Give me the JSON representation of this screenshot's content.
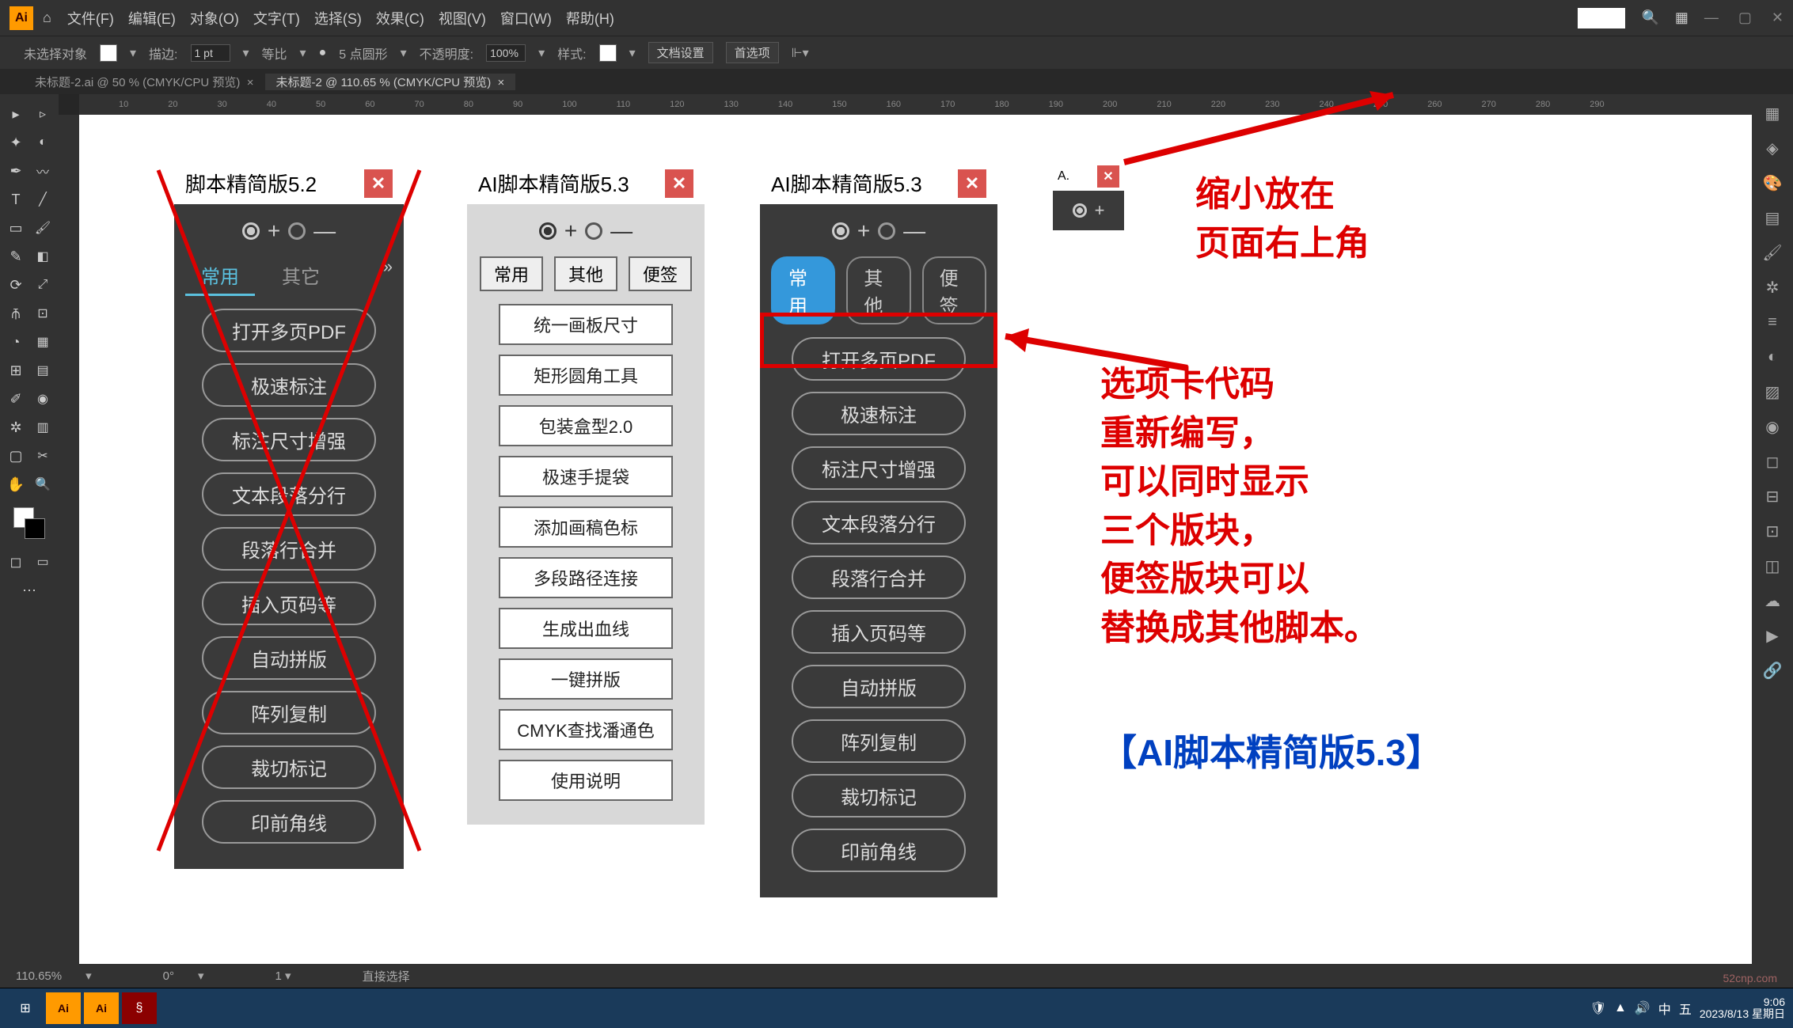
{
  "menubar": {
    "items": [
      "文件(F)",
      "编辑(E)",
      "对象(O)",
      "文字(T)",
      "选择(S)",
      "效果(C)",
      "视图(V)",
      "窗口(W)",
      "帮助(H)"
    ]
  },
  "optbar": {
    "no_sel": "未选择对象",
    "stroke_lbl": "描边:",
    "stroke_val": "1 pt",
    "uniform": "等比",
    "pt5": "5 点圆形",
    "opacity_lbl": "不透明度:",
    "opacity_val": "100%",
    "style_lbl": "样式:",
    "doc_setup": "文档设置",
    "prefs": "首选项"
  },
  "tabs": {
    "t1": "未标题-2.ai @ 50 % (CMYK/CPU 预览)",
    "t2": "未标题-2 @ 110.65 % (CMYK/CPU 预览)"
  },
  "panel52": {
    "title": "脚本精简版5.2",
    "tabs": [
      "常用",
      "其它"
    ],
    "buttons": [
      "打开多页PDF",
      "极速标注",
      "标注尺寸增强",
      "文本段落分行",
      "段落行合并",
      "插入页码等",
      "自动拼版",
      "阵列复制",
      "裁切标记",
      "印前角线"
    ]
  },
  "panel53light": {
    "title": "AI脚本精简版5.3",
    "tabs": [
      "常用",
      "其他",
      "便签"
    ],
    "buttons": [
      "统一画板尺寸",
      "矩形圆角工具",
      "包装盒型2.0",
      "极速手提袋",
      "添加画稿色标",
      "多段路径连接",
      "生成出血线",
      "一键拼版",
      "CMYK查找潘通色",
      "使用说明"
    ]
  },
  "panel53dark": {
    "title": "AI脚本精简版5.3",
    "tabs": [
      "常用",
      "其他",
      "便签"
    ],
    "buttons": [
      "打开多页PDF",
      "极速标注",
      "标注尺寸增强",
      "文本段落分行",
      "段落行合并",
      "插入页码等",
      "自动拼版",
      "阵列复制",
      "裁切标记",
      "印前角线"
    ]
  },
  "mini": {
    "title": "A."
  },
  "anno1": "缩小放在\n页面右上角",
  "anno2": "选项卡代码\n重新编写，\n可以同时显示\n三个版块，\n便签版块可以\n替换成其他脚本。",
  "blue_title": "【AI脚本精简版5.3】",
  "status": {
    "zoom": "110.65%",
    "mode": "直接选择"
  },
  "taskbar": {
    "time": "9:06",
    "date": "2023/8/13 星期日"
  },
  "watermark": "52cnp.com"
}
